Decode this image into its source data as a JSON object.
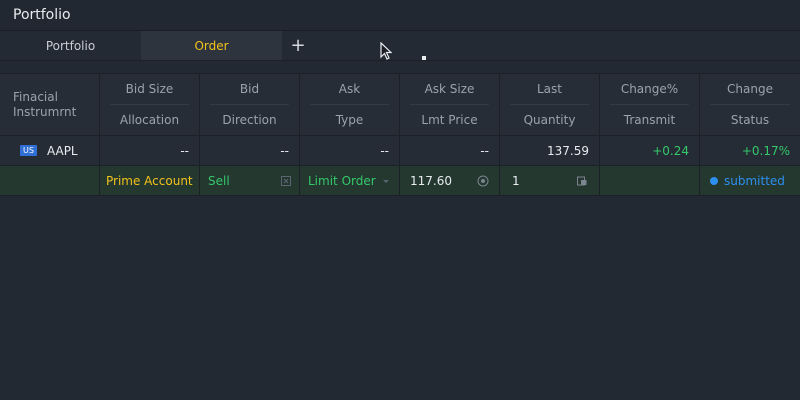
{
  "window": {
    "title": "Portfolio"
  },
  "tabs": [
    {
      "label": "Portfolio",
      "active": false
    },
    {
      "label": "Order",
      "active": true
    }
  ],
  "add_tab_icon": "plus-icon",
  "table": {
    "instrument_header": "Finacial Instrumrnt",
    "columns": [
      {
        "top": "Bid Size",
        "bottom": "Allocation"
      },
      {
        "top": "Bid",
        "bottom": "Direction"
      },
      {
        "top": "Ask",
        "bottom": "Type"
      },
      {
        "top": "Ask Size",
        "bottom": "Lmt Price"
      },
      {
        "top": "Last",
        "bottom": "Quantity"
      },
      {
        "top": "Change%",
        "bottom": "Transmit"
      },
      {
        "top": "Change",
        "bottom": "Status"
      }
    ],
    "quote_row": {
      "market_badge": "US",
      "symbol": "AAPL",
      "bid_size": "--",
      "bid": "--",
      "ask": "--",
      "ask_size": "--",
      "last": "137.59",
      "change_pct": "+0.24",
      "change": "+0.17%"
    },
    "order_row": {
      "allocation": "Prime Account",
      "direction": "Sell",
      "type": "Limit Order",
      "lmt_price": "117.60",
      "quantity": "1",
      "transmit": "",
      "status": "submitted"
    }
  },
  "colors": {
    "accent_yellow": "#f2c21b",
    "positive_green": "#33c86a",
    "status_blue": "#2d8ff0",
    "badge_blue": "#2f6fd6"
  }
}
